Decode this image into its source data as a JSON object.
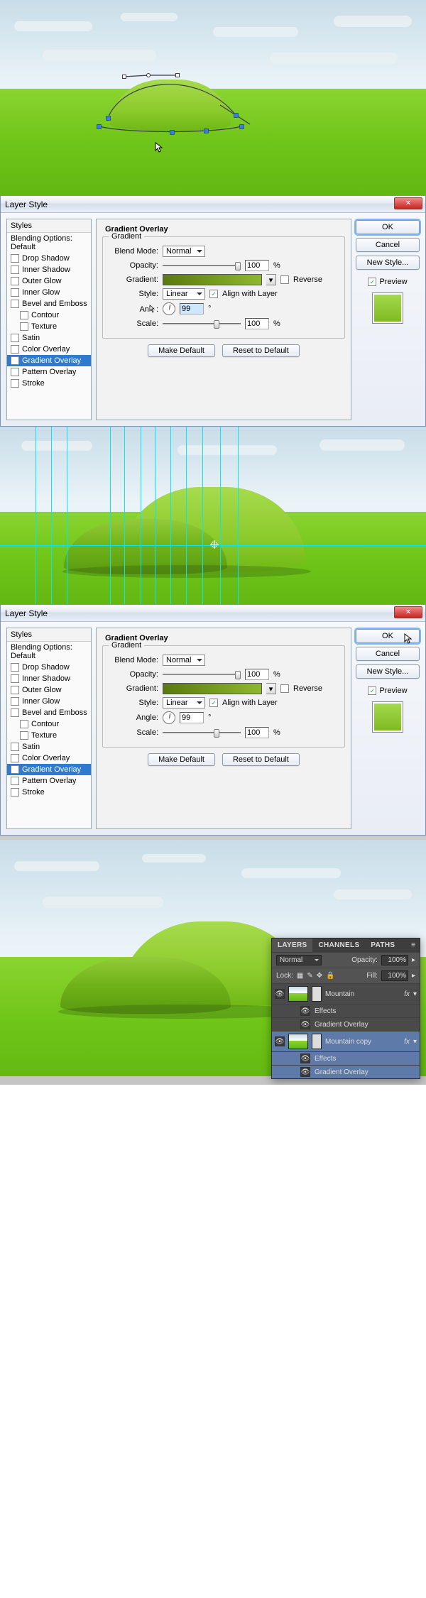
{
  "dialog": {
    "title": "Layer Style",
    "styles_header": "Styles",
    "blending_default": "Blending Options: Default",
    "items": {
      "drop_shadow": "Drop Shadow",
      "inner_shadow": "Inner Shadow",
      "outer_glow": "Outer Glow",
      "inner_glow": "Inner Glow",
      "bevel_emboss": "Bevel and Emboss",
      "contour": "Contour",
      "texture": "Texture",
      "satin": "Satin",
      "color_overlay": "Color Overlay",
      "gradient_overlay": "Gradient Overlay",
      "pattern_overlay": "Pattern Overlay",
      "stroke": "Stroke"
    },
    "section": {
      "title": "Gradient Overlay",
      "sub": "Gradient",
      "blend_mode_lbl": "Blend Mode:",
      "blend_mode_val": "Normal",
      "opacity_lbl": "Opacity:",
      "opacity_val": "100",
      "pct": "%",
      "gradient_lbl": "Gradient:",
      "reverse": "Reverse",
      "style_lbl": "Style:",
      "style_val": "Linear",
      "align": "Align with Layer",
      "angle_lbl": "Angle:",
      "angle_val": "99",
      "deg": "°",
      "scale_lbl": "Scale:",
      "scale_val": "100",
      "make_default": "Make Default",
      "reset_default": "Reset to Default"
    },
    "buttons": {
      "ok": "OK",
      "cancel": "Cancel",
      "new_style": "New Style...",
      "preview": "Preview"
    }
  },
  "layers_panel": {
    "tabs": {
      "layers": "LAYERS",
      "channels": "CHANNELS",
      "paths": "PATHS"
    },
    "blend": "Normal",
    "opacity_lbl": "Opacity:",
    "opacity_val": "100%",
    "lock_lbl": "Lock:",
    "fill_lbl": "Fill:",
    "fill_val": "100%",
    "layer1": "Mountain",
    "layer2": "Mountain copy",
    "effects": "Effects",
    "grad_ov": "Gradient Overlay",
    "fx": "fx"
  }
}
